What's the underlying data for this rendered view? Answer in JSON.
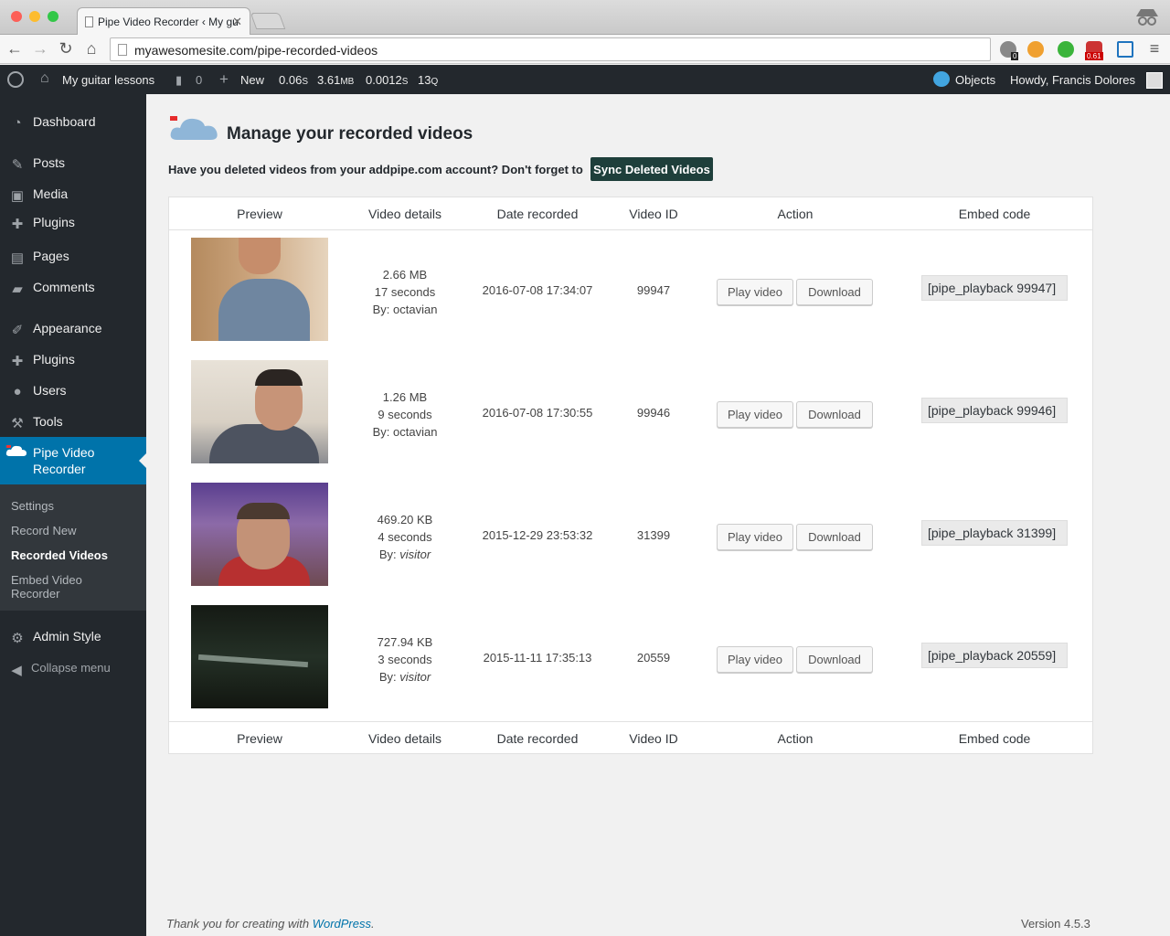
{
  "browser": {
    "tab_title": "Pipe Video Recorder ‹ My gu",
    "url": "myawesomesite.com/pipe-recorded-videos",
    "ext_badges": [
      "0",
      "0.61"
    ]
  },
  "adminbar": {
    "site_name": "My guitar lessons",
    "comments_count": "0",
    "new_label": "New",
    "stats": {
      "time": "0.06",
      "time_unit": "S",
      "mem": "3.61",
      "mem_unit": "MB",
      "q_time": "0.0012",
      "q_time_unit": "S",
      "queries": "13",
      "queries_unit": "Q"
    },
    "objects_label": "Objects",
    "howdy": "Howdy, Francis Dolores"
  },
  "sidebar": {
    "items": [
      {
        "label": "Dashboard",
        "icon": "dashboard-icon"
      },
      {
        "label": "Posts",
        "icon": "pin-icon"
      },
      {
        "label": "Media",
        "icon": "media-icon"
      },
      {
        "label": "Plugins",
        "icon": "plugin-icon"
      },
      {
        "label": "Pages",
        "icon": "page-icon"
      },
      {
        "label": "Comments",
        "icon": "comment-icon"
      },
      {
        "label": "Appearance",
        "icon": "brush-icon"
      },
      {
        "label": "Plugins",
        "icon": "plugin-icon"
      },
      {
        "label": "Users",
        "icon": "user-icon"
      },
      {
        "label": "Tools",
        "icon": "wrench-icon"
      }
    ],
    "pipe": {
      "line1": "Pipe Video",
      "line2": "Recorder"
    },
    "submenu": [
      {
        "label": "Settings"
      },
      {
        "label": "Record New"
      },
      {
        "label": "Recorded Videos",
        "current": true
      },
      {
        "label": "Embed Video",
        "label2": "Recorder"
      }
    ],
    "admin_style": "Admin Style",
    "collapse": "Collapse menu"
  },
  "page": {
    "title": "Manage your recorded videos",
    "sync_text": "Have you deleted videos from your addpipe.com account? Don't forget to",
    "sync_button": "Sync Deleted Videos"
  },
  "table": {
    "headers": [
      "Preview",
      "Video details",
      "Date recorded",
      "Video ID",
      "Action",
      "Embed code"
    ],
    "play_label": "Play video",
    "download_label": "Download",
    "rows": [
      {
        "size": "2.66 MB",
        "duration": "17 seconds",
        "by": "By:",
        "user": "octavian",
        "user_italic": false,
        "date": "2016-07-08 17:34:07",
        "id": "99947",
        "embed": "[pipe_playback 99947]"
      },
      {
        "size": "1.26 MB",
        "duration": "9 seconds",
        "by": "By:",
        "user": "octavian",
        "user_italic": false,
        "date": "2016-07-08 17:30:55",
        "id": "99946",
        "embed": "[pipe_playback 99946]"
      },
      {
        "size": "469.20 KB",
        "duration": "4 seconds",
        "by": "By:",
        "user": "visitor",
        "user_italic": true,
        "date": "2015-12-29 23:53:32",
        "id": "31399",
        "embed": "[pipe_playback 31399]"
      },
      {
        "size": "727.94 KB",
        "duration": "3 seconds",
        "by": "By:",
        "user": "visitor",
        "user_italic": true,
        "date": "2015-11-11 17:35:13",
        "id": "20559",
        "embed": "[pipe_playback 20559]"
      }
    ]
  },
  "footer": {
    "thanks": "Thank you for creating with",
    "wp_link": "WordPress",
    "period": ".",
    "version": "Version 4.5.3"
  },
  "colors": {
    "admin_bg": "#23282d",
    "accent": "#0073aa",
    "sync_btn": "#1e3f3b"
  }
}
